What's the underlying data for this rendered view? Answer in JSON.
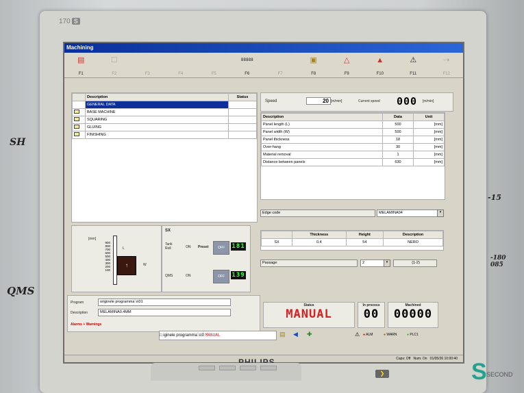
{
  "monitor": {
    "model": "170",
    "model_suffix": "S",
    "brand": "PHILIPS"
  },
  "handwriting": {
    "left_top": "SH",
    "left_bottom": "QMS",
    "right_top": "-15",
    "right_mid": "-180\n085"
  },
  "watermark": {
    "text": "SECOND"
  },
  "app": {
    "title": "Machining"
  },
  "toolbar": {
    "keys": [
      {
        "label": "F1",
        "icon": "machine-icon"
      },
      {
        "label": "F2",
        "icon": "document-icon"
      },
      {
        "label": "F3",
        "icon": ""
      },
      {
        "label": "F4",
        "icon": ""
      },
      {
        "label": "F5",
        "icon": ""
      },
      {
        "label": "F6",
        "icon": "counter-icon",
        "icon_text": "88888"
      },
      {
        "label": "F7",
        "icon": ""
      },
      {
        "label": "F8",
        "icon": "folder-icon"
      },
      {
        "label": "F9",
        "icon": "reference-icon"
      },
      {
        "label": "F10",
        "icon": "reset-icon"
      },
      {
        "label": "F11",
        "icon": "warning-icon"
      },
      {
        "label": "F12",
        "icon": "exit-icon"
      }
    ]
  },
  "tree": {
    "headers": [
      "Description",
      "Status"
    ],
    "rows": [
      {
        "label": "GENERAL DATA",
        "folder": false,
        "selected": true
      },
      {
        "label": "BASE MACHINE",
        "folder": true
      },
      {
        "label": "SQUARING",
        "folder": true
      },
      {
        "label": "GLUING",
        "folder": true
      },
      {
        "label": "FINISHING",
        "folder": true
      }
    ]
  },
  "speed": {
    "label": "Speed",
    "value": "20",
    "unit": "[m/min]",
    "current_label": "Current speed",
    "current_value": "000",
    "current_unit": "[m/min]"
  },
  "params": {
    "headers": [
      "Description",
      "Data",
      "Unit"
    ],
    "rows": [
      [
        "Panel length (L)",
        "500",
        "[mm]"
      ],
      [
        "Panel width (W)",
        "500",
        "[mm]"
      ],
      [
        "Panel thickness",
        "18",
        "[mm]"
      ],
      [
        "Over-hang",
        "30",
        "[mm]"
      ],
      [
        "Material removal",
        "1",
        "[mm]"
      ],
      [
        "Distance between panels",
        "630",
        "[mm]"
      ]
    ]
  },
  "edge": {
    "label": "Edge code",
    "value": "MELAMINA04"
  },
  "edge_table": {
    "headers": [
      "",
      "Thickness",
      "Height",
      "Description"
    ],
    "row": [
      "SX",
      "0.4",
      "54",
      "NERO"
    ]
  },
  "passage": {
    "label": "Passage",
    "value": "2",
    "range": "(1-2)"
  },
  "diagram": {
    "unit": "[mm]",
    "scale": [
      "900",
      "800",
      "700",
      "600",
      "500",
      "400",
      "300",
      "200",
      "100"
    ],
    "l": "L",
    "w": "W"
  },
  "sx": {
    "title": "SX",
    "tank_label": "Tank\nRoll",
    "on": "ON",
    "preset": "Preset",
    "off": "OFF",
    "tank_value": "181",
    "qms_label": "QMS",
    "qms_on": "ON",
    "qms_off": "OFF",
    "qms_value": "139"
  },
  "program": {
    "label": "Program",
    "value": "originele programma`s\\01",
    "desc_label": "Description",
    "desc_value": "MELAMINA0.4MM"
  },
  "alarms": {
    "label": "Alarms + Warnings"
  },
  "status": {
    "label": "Status",
    "value": "MANUAL",
    "inprocess_label": "In process",
    "inprocess_value": "00",
    "machined_label": "Machined",
    "machined_value": "00000"
  },
  "footer": {
    "program_text": "iginele programma`s\\0",
    "mode_text": "MANUAL",
    "alm": "ALM",
    "warn": "WARN",
    "plc": "PLC1",
    "caps": "Caps: Off",
    "num": "Num: On",
    "datetime": "01/05/26 10:00:40"
  }
}
